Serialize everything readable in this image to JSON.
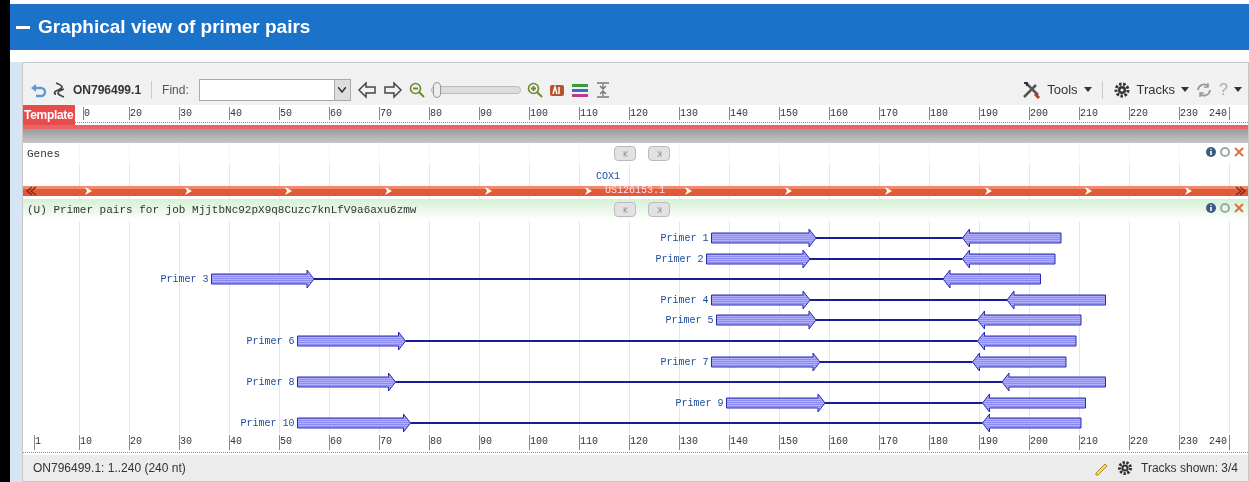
{
  "header": {
    "title": "Graphical view of primer pairs"
  },
  "toolbar": {
    "sequence": "ON796499.1",
    "find_label": "Find:",
    "zoom_slider": {
      "level": 0.02
    },
    "tools": "Tools",
    "tracks": "Tracks",
    "help": "?"
  },
  "ruler_top": {
    "label": "Template",
    "ticks": [
      "0",
      "20",
      "30",
      "40",
      "50",
      "60",
      "70",
      "80",
      "90",
      "100",
      "110",
      "120",
      "130",
      "140",
      "150",
      "160",
      "170",
      "180",
      "190",
      "200",
      "210",
      "220",
      "230",
      "240"
    ]
  },
  "genes_track": {
    "title": "Genes",
    "gene": "COX1",
    "feature": "US126153.1"
  },
  "primer_track": {
    "title": "(U) Primer pairs for job MjjtbNc92pX9q8Cuzc7knLfV9a6axu6zmw",
    "primers": [
      {
        "label": "Primer 1"
      },
      {
        "label": "Primer 2"
      },
      {
        "label": "Primer 3"
      },
      {
        "label": "Primer 4"
      },
      {
        "label": "Primer 5"
      },
      {
        "label": "Primer 6"
      },
      {
        "label": "Primer 7"
      },
      {
        "label": "Primer 8"
      },
      {
        "label": "Primer 9"
      },
      {
        "label": "Primer 10"
      }
    ]
  },
  "ruler_bottom": {
    "ticks": [
      "1",
      "10",
      "20",
      "30",
      "40",
      "50",
      "60",
      "70",
      "80",
      "90",
      "100",
      "110",
      "120",
      "130",
      "140",
      "150",
      "160",
      "170",
      "180",
      "190",
      "200",
      "210",
      "220",
      "230",
      "240"
    ]
  },
  "status_bar": {
    "range": "ON796499.1: 1..240 (240 nt)",
    "tracks_shown": "Tracks shown: 3/4"
  }
}
